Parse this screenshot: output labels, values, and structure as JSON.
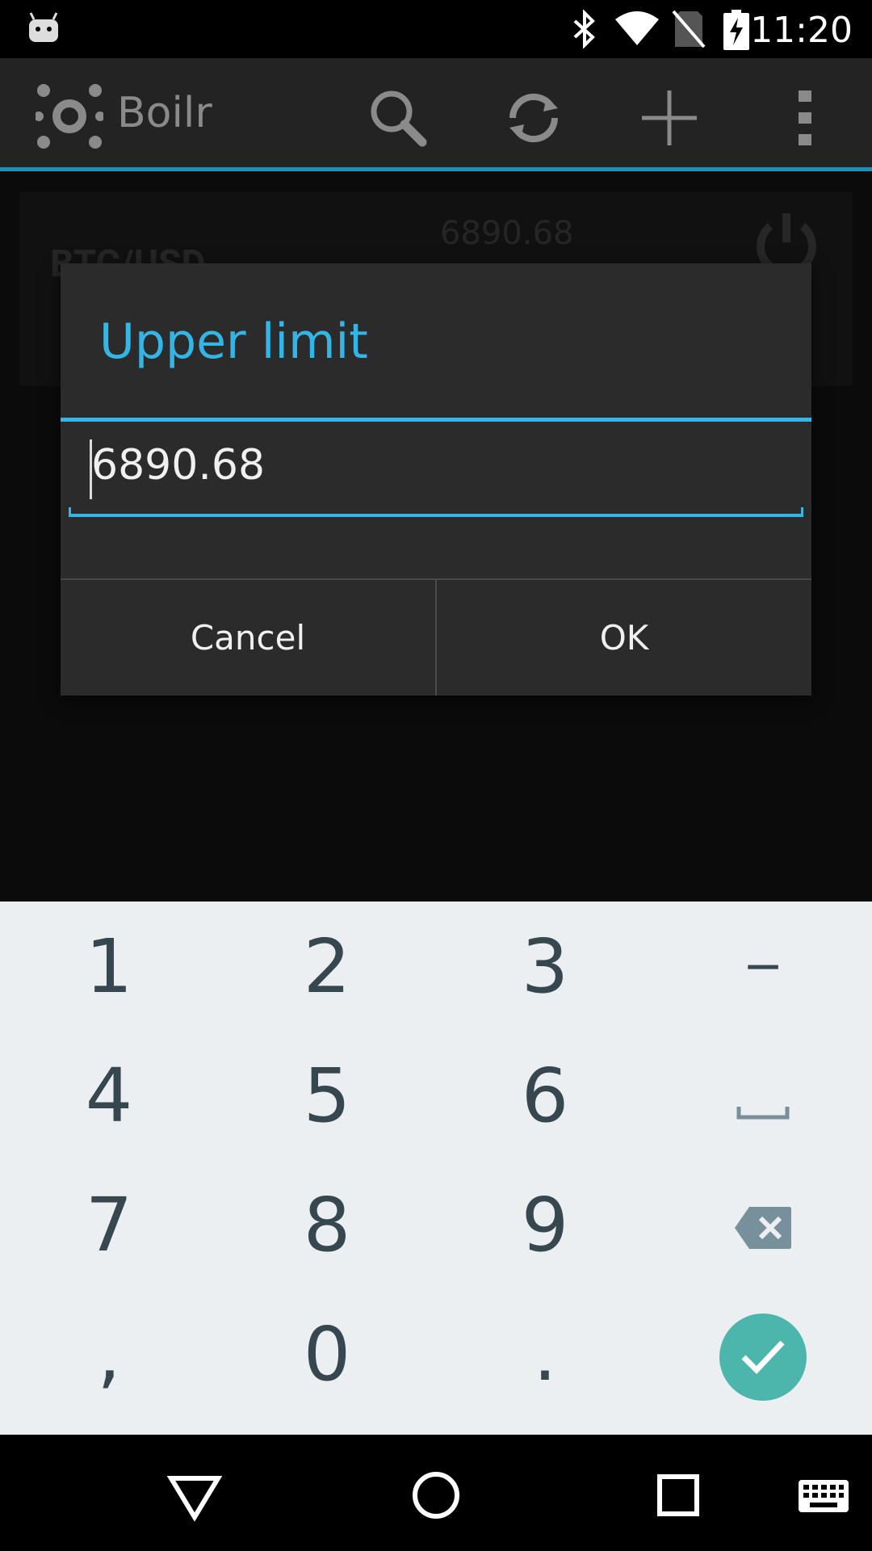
{
  "status_bar": {
    "time": "11:20",
    "icons": [
      "android-debug-icon",
      "bluetooth-icon",
      "wifi-icon",
      "no-sim-icon",
      "battery-charging-icon"
    ]
  },
  "app_bar": {
    "title": "Boilr",
    "actions": [
      "search-icon",
      "refresh-icon",
      "add-icon",
      "overflow-menu-icon"
    ]
  },
  "background_list": {
    "pair": "BTC/USD",
    "price": "6890.68"
  },
  "dialog": {
    "title": "Upper limit",
    "input_value": "6890.68",
    "cancel_label": "Cancel",
    "ok_label": "OK"
  },
  "keyboard": {
    "rows": [
      [
        "1",
        "2",
        "3",
        "−"
      ],
      [
        "4",
        "5",
        "6",
        "space"
      ],
      [
        "7",
        "8",
        "9",
        "backspace"
      ],
      [
        ",",
        "0",
        ".",
        "done"
      ]
    ]
  },
  "nav_bar": {
    "buttons": [
      "back-icon",
      "home-icon",
      "recents-icon",
      "keyboard-switch-icon"
    ]
  },
  "colors": {
    "accent": "#33b5e5",
    "done_key": "#4db6ac",
    "keyboard_bg": "#eceff1",
    "key_text": "#37474f"
  }
}
